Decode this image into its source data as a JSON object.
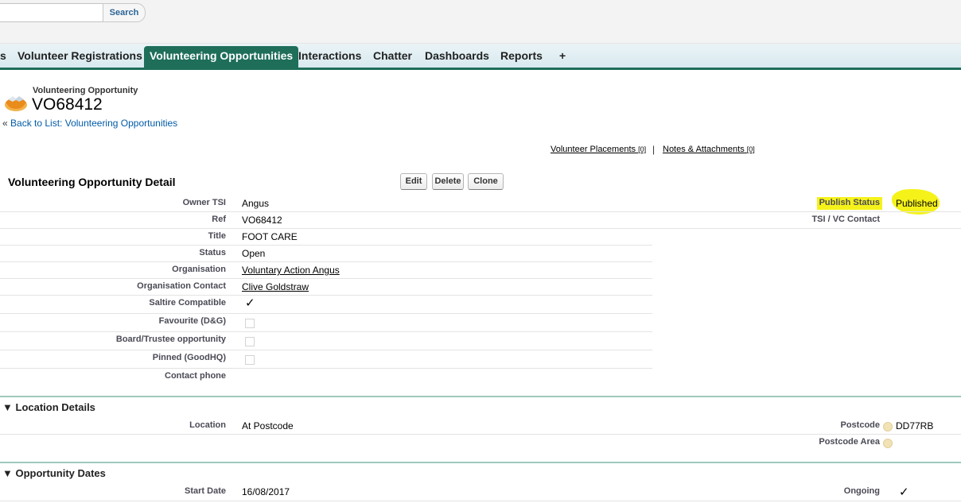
{
  "header": {
    "search_placeholder": "",
    "search_label": "Search"
  },
  "tabs": [
    {
      "label": "s"
    },
    {
      "label": "Volunteer Registrations"
    },
    {
      "label": "Volunteering Opportunities"
    },
    {
      "label": "Interactions"
    },
    {
      "label": "Chatter"
    },
    {
      "label": "Dashboards"
    },
    {
      "label": "Reports"
    },
    {
      "label": "+"
    }
  ],
  "page_header": {
    "type": "Volunteering Opportunity",
    "title": "VO68412",
    "back_prefix": "«",
    "back_link": "Back to List: Volunteering Opportunities",
    "icon": "handshake-icon"
  },
  "related_links": [
    {
      "label": "Volunteer Placements",
      "count": "[0]"
    },
    {
      "label": "Notes & Attachments",
      "count": "[0]"
    }
  ],
  "related_sep": "|",
  "detail": {
    "title": "Volunteering Opportunity Detail",
    "buttons": {
      "edit": "Edit",
      "delete": "Delete",
      "clone": "Clone"
    },
    "fields": [
      {
        "label": "Owner TSI",
        "value": "Angus"
      },
      {
        "label": "Ref",
        "value": "VO68412"
      },
      {
        "label": "Title",
        "value": "FOOT CARE"
      },
      {
        "label": "Status",
        "value": "Open"
      },
      {
        "label": "Organisation",
        "value": "Voluntary Action Angus"
      },
      {
        "label": "Organisation Contact",
        "value": "Clive Goldstraw"
      },
      {
        "label": "Saltire Compatible",
        "value": "✓"
      },
      {
        "label": "Favourite (D&G)",
        "value": ""
      },
      {
        "label": "Board/Trustee opportunity",
        "value": ""
      },
      {
        "label": "Pinned (GoodHQ)",
        "value": ""
      },
      {
        "label": "Contact phone",
        "value": ""
      }
    ],
    "right_fields": [
      {
        "label": "Publish Status",
        "value": "Published"
      },
      {
        "label": "TSI / VC Contact",
        "value": ""
      }
    ]
  },
  "location": {
    "title": "Location Details",
    "arrow": "▼",
    "location_label": "Location",
    "location_value": "At Postcode",
    "postcode_label": "Postcode",
    "postcode_value": "DD77RB",
    "area_label": "Postcode Area",
    "area_value": ""
  },
  "dates": {
    "title": "Opportunity Dates",
    "arrow": "▼",
    "start_label": "Start Date",
    "start_value": "16/08/2017",
    "ongoing_label": "Ongoing",
    "ongoing_value": "✓"
  },
  "colors": {
    "tab_active": "#1e6e5a",
    "highlight": "#f5f21a",
    "link": "#015ba7"
  }
}
